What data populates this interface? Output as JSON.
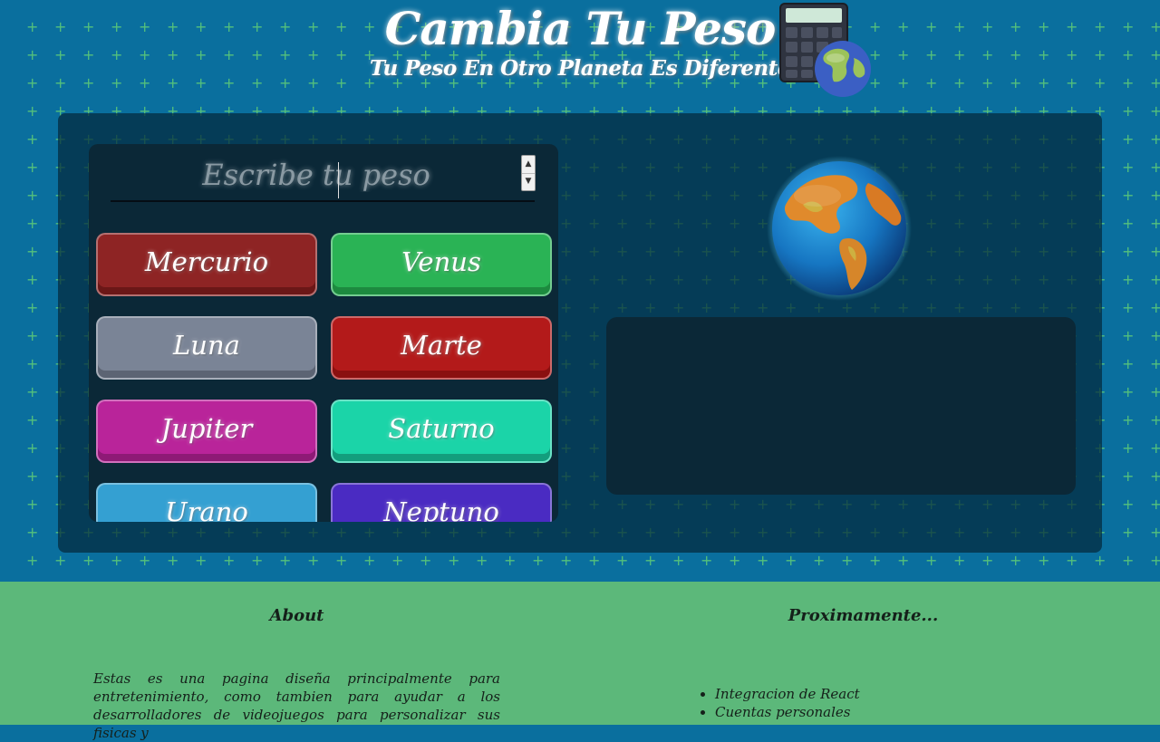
{
  "header": {
    "title": "Cambia Tu Peso",
    "subtitle": "Tu Peso En Otro Planeta Es Diferente"
  },
  "form": {
    "weight_placeholder": "Escribe tu peso",
    "weight_value": "",
    "planets": [
      {
        "label": "Mercurio",
        "color": "#8e2424",
        "shadow": "#6b1717"
      },
      {
        "label": "Venus",
        "color": "#2ab355",
        "shadow": "#1d8a3f"
      },
      {
        "label": "Luna",
        "color": "#7a8496",
        "shadow": "#5c6473"
      },
      {
        "label": "Marte",
        "color": "#b31a1a",
        "shadow": "#8a1010"
      },
      {
        "label": "Jupiter",
        "color": "#b9249a",
        "shadow": "#8e1a76"
      },
      {
        "label": "Saturno",
        "color": "#1bd4a8",
        "shadow": "#139e7d"
      },
      {
        "label": "Urano",
        "color": "#34a0d2",
        "shadow": "#247aa2"
      },
      {
        "label": "Neptuno",
        "color": "#4a2bc2",
        "shadow": "#361f93"
      }
    ]
  },
  "result": {
    "text": ""
  },
  "footer": {
    "about_title": "About",
    "about_text": "Estas es una pagina diseña principalmente para entretenimiento, como tambien para ayudar a los desarrolladores de videojuegos para personalizar sus fisicas y",
    "soon_title": "Proximamente...",
    "soon_items": [
      "Integracion de React",
      "Cuentas personales"
    ]
  },
  "colors": {
    "background": "#0a6f9e",
    "pattern": "#4fc07a",
    "footer": "#5cb87a",
    "card": "#0b2837"
  }
}
